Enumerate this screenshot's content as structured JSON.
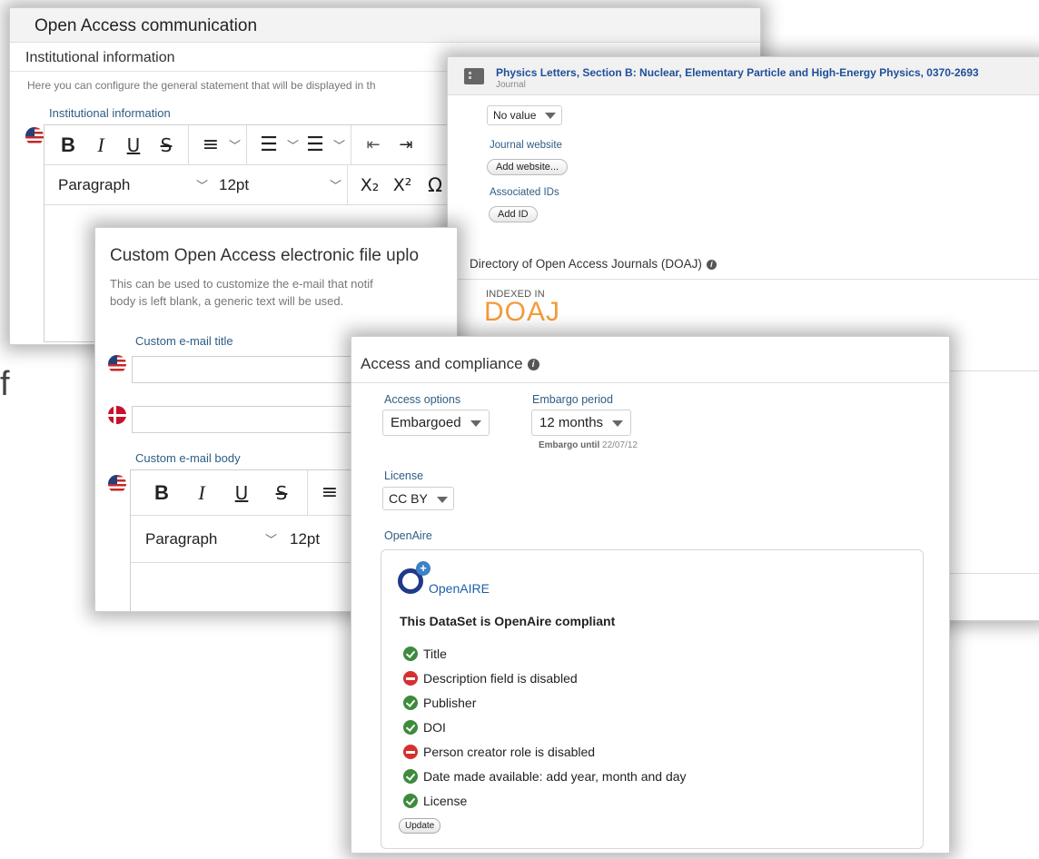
{
  "panel1": {
    "title": "Open Access communication",
    "section": "Institutional information",
    "description": "Here you can configure the general statement that will be displayed in th",
    "field_label": "Institutional information",
    "toolbar": {
      "bold": "B",
      "italic": "I",
      "underline": "U",
      "strike": "S",
      "block_format": "Paragraph",
      "font_size": "12pt",
      "subscript": "X₂",
      "superscript": "X²",
      "special_char": "Ω"
    }
  },
  "panel2": {
    "journal_title": "Physics Letters, Section B: Nuclear, Elementary Particle and High-Energy Physics, 0370-2693",
    "journal_subtitle": "Journal",
    "select_value": "No value",
    "website_label": "Journal website",
    "add_website": "Add website...",
    "ids_label": "Associated IDs",
    "add_id": "Add ID",
    "doaj_title": "Directory of Open Access Journals (DOAJ)",
    "indexed_in": "INDEXED IN",
    "doaj_logo": "DOAJ"
  },
  "panel3": {
    "title": "Custom Open Access electronic file uplo",
    "desc_line1": "This can be used to customize the e-mail that notif",
    "desc_line2": "body is left blank, a generic text will be used.",
    "email_title_label": "Custom e-mail title",
    "email_body_label": "Custom e-mail body",
    "toolbar": {
      "bold": "B",
      "italic": "I",
      "underline": "U",
      "strike": "S",
      "block_format": "Paragraph",
      "font_size": "12pt"
    }
  },
  "panel4": {
    "title": "Access and compliance",
    "access_options_label": "Access options",
    "access_options_value": "Embargoed",
    "embargo_label": "Embargo period",
    "embargo_value": "12 months",
    "embargo_until_label": "Embargo until",
    "embargo_until_value": "22/07/12",
    "license_label": "License",
    "license_value": "CC BY",
    "openaire_label": "OpenAire",
    "openaire_logo_text": "OpenAIRE",
    "compliant_text": "This DataSet is OpenAire compliant",
    "checks": [
      {
        "label": "Title",
        "status": "ok"
      },
      {
        "label": "Description field is disabled",
        "status": "disabled"
      },
      {
        "label": "Publisher",
        "status": "ok"
      },
      {
        "label": "DOI",
        "status": "ok"
      },
      {
        "label": "Person creator role is disabled",
        "status": "disabled"
      },
      {
        "label": "Date made available: add year, month and day",
        "status": "ok"
      },
      {
        "label": "License",
        "status": "ok"
      }
    ],
    "update_button": "Update"
  },
  "edge_letter": "f",
  "colors": {
    "link_blue": "#2d5d86",
    "journal_blue": "#1f4f99",
    "ok_green": "#3d8b3d",
    "error_red": "#d43030",
    "doaj_orange": "#f39c3c"
  }
}
